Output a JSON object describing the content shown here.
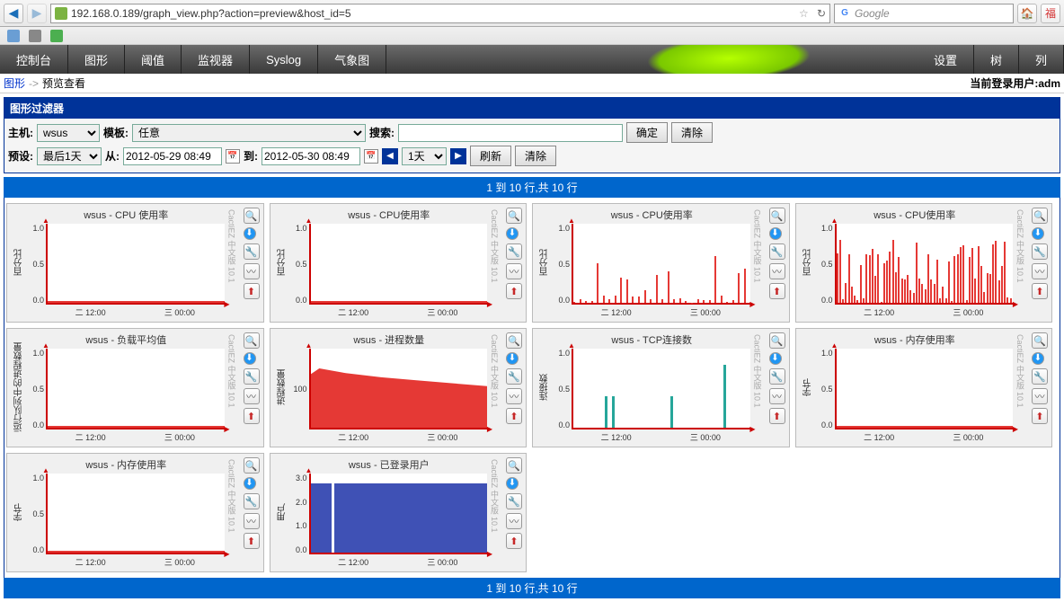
{
  "browser": {
    "url": "192.168.0.189/graph_view.php?action=preview&host_id=5",
    "search_placeholder": "Google",
    "bookmarks": []
  },
  "nav": {
    "tabs": [
      "控制台",
      "图形",
      "阈值",
      "监视器",
      "Syslog",
      "气象图"
    ],
    "right_tabs": [
      "设置",
      "树",
      "列"
    ]
  },
  "breadcrumb": {
    "link": "图形",
    "current": "预览查看",
    "login_label": "当前登录用户:",
    "login_user": "adm"
  },
  "filter": {
    "title": "图形过滤器",
    "host_label": "主机:",
    "host_value": "wsus",
    "template_label": "模板:",
    "template_value": "任意",
    "search_label": "搜索:",
    "confirm": "确定",
    "clear": "清除",
    "preset_label": "预设:",
    "preset_value": "最后1天",
    "from_label": "从:",
    "from_value": "2012-05-29 08:49",
    "to_label": "到:",
    "to_value": "2012-05-30 08:49",
    "range_value": "1天",
    "refresh": "刷新",
    "clear2": "清除"
  },
  "pager": "1 到 10 行,共 10 行",
  "watermark": "CactiEZ 中文版 10.1",
  "x_ticks": [
    "二 12:00",
    "三 00:00"
  ],
  "graphs": [
    {
      "title": "wsus - CPU 使用率",
      "ylabel": "百分比",
      "yticks": [
        "1.0",
        "0.5",
        "0.0"
      ],
      "series": "flat",
      "color": "#e53935"
    },
    {
      "title": "wsus - CPU使用率",
      "ylabel": "百分比",
      "yticks": [
        "1.0",
        "0.5",
        "0.0"
      ],
      "series": "flat",
      "color": "#e53935"
    },
    {
      "title": "wsus - CPU使用率",
      "ylabel": "百分比",
      "yticks": [
        "1.0",
        "0.5",
        "0.0"
      ],
      "series": "spikes_med",
      "color": "#e53935"
    },
    {
      "title": "wsus - CPU使用率",
      "ylabel": "百分比",
      "yticks": [
        "1.0",
        "0.5",
        "0.0"
      ],
      "series": "spikes_high",
      "color": "#e53935"
    },
    {
      "title": "wsus - 负载平均值",
      "ylabel": "运行队列中的进程数量",
      "yticks": [
        "1.0",
        "0.5",
        "0.0"
      ],
      "series": "flat",
      "color": "#e53935"
    },
    {
      "title": "wsus - 进程数量",
      "ylabel": "进程数量",
      "yticks": [
        "",
        "100",
        ""
      ],
      "series": "area_high",
      "color": "#e53935"
    },
    {
      "title": "wsus - TCP连接数",
      "ylabel": "连接数",
      "yticks": [
        "1.0",
        "0.5",
        "0.0"
      ],
      "series": "teal_spikes",
      "color": "#26a69a"
    },
    {
      "title": "wsus - 内存使用率",
      "ylabel": "字节",
      "yticks": [
        "1.0",
        "0.5",
        "0.0"
      ],
      "series": "flat",
      "color": "#e53935"
    },
    {
      "title": "wsus - 内存使用率",
      "ylabel": "字节",
      "yticks": [
        "1.0",
        "0.5",
        "0.0"
      ],
      "series": "flat",
      "color": "#e53935"
    },
    {
      "title": "wsus - 已登录用户",
      "ylabel": "用户",
      "yticks": [
        "3.0",
        "2.0",
        "1.0",
        "0.0"
      ],
      "series": "area_blue",
      "color": "#3f51b5"
    }
  ],
  "chart_data": [
    {
      "type": "area",
      "title": "wsus - CPU 使用率",
      "ylabel": "百分比",
      "x": [
        "二 12:00",
        "三 00:00"
      ],
      "ylim": [
        0,
        1.5
      ],
      "values": "near-zero"
    },
    {
      "type": "area",
      "title": "wsus - CPU使用率",
      "ylabel": "百分比",
      "x": [
        "二 12:00",
        "三 00:00"
      ],
      "ylim": [
        0,
        1.5
      ],
      "values": "near-zero"
    },
    {
      "type": "area",
      "title": "wsus - CPU使用率",
      "ylabel": "百分比",
      "x": [
        "二 12:00",
        "三 00:00"
      ],
      "ylim": [
        0,
        1.5
      ],
      "values": "intermittent spikes 0–1.0"
    },
    {
      "type": "area",
      "title": "wsus - CPU使用率",
      "ylabel": "百分比",
      "x": [
        "二 12:00",
        "三 00:00"
      ],
      "ylim": [
        0,
        1.5
      ],
      "values": "dense spikes 0–1.2"
    },
    {
      "type": "area",
      "title": "wsus - 负载平均值",
      "ylabel": "运行队列中的进程数量",
      "x": [
        "二 12:00",
        "三 00:00"
      ],
      "ylim": [
        0,
        1.5
      ],
      "values": "near-zero"
    },
    {
      "type": "area",
      "title": "wsus - 进程数量",
      "ylabel": "进程数量",
      "x": [
        "二 12:00",
        "三 00:00"
      ],
      "ylim": [
        0,
        150
      ],
      "values": "decreasing ~130→100"
    },
    {
      "type": "bar",
      "title": "wsus - TCP连接数",
      "ylabel": "连接数",
      "x": [
        "二 12:00",
        "三 00:00"
      ],
      "ylim": [
        0,
        1.2
      ],
      "values": "sparse spikes ~0.5–1.0"
    },
    {
      "type": "area",
      "title": "wsus - 内存使用率",
      "ylabel": "字节",
      "x": [
        "二 12:00",
        "三 00:00"
      ],
      "ylim": [
        0,
        1.5
      ],
      "values": "near-zero"
    },
    {
      "type": "area",
      "title": "wsus - 内存使用率",
      "ylabel": "字节",
      "x": [
        "二 12:00",
        "三 00:00"
      ],
      "ylim": [
        0,
        1.5
      ],
      "values": "near-zero"
    },
    {
      "type": "area",
      "title": "wsus - 已登录用户",
      "ylabel": "用户",
      "x": [
        "二 12:00",
        "三 00:00"
      ],
      "ylim": [
        0,
        3.0
      ],
      "values": "flat ~3.0"
    }
  ]
}
